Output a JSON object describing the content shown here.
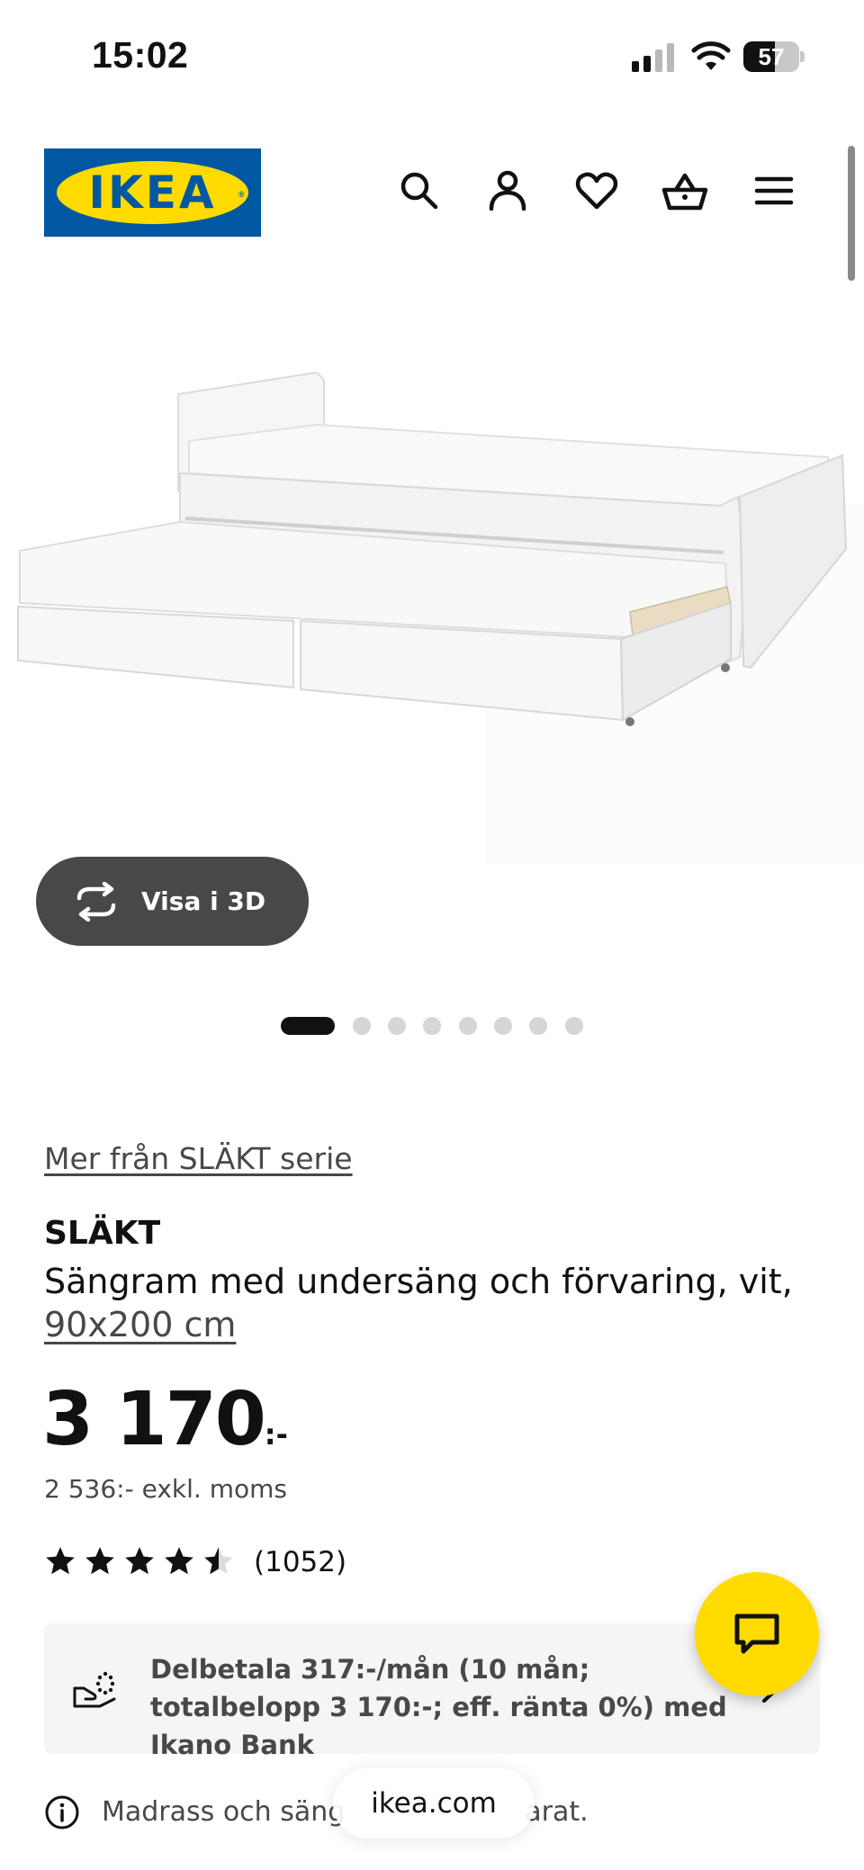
{
  "status_bar": {
    "time": "15:02",
    "battery": "57",
    "battery_level": 0.57,
    "icons": [
      "cellular-signal-icon",
      "wifi-icon",
      "battery-icon"
    ]
  },
  "header": {
    "logo_text": "IKEA",
    "logo_colors": {
      "background": "#0058a3",
      "oval": "#ffdb00"
    },
    "icons": [
      "search-icon",
      "account-icon",
      "heart-icon",
      "basket-icon",
      "menu-icon"
    ]
  },
  "gallery": {
    "view3d_label": "Visa i 3D",
    "dot_count": 8,
    "active_dot": 0
  },
  "product": {
    "series_link": "Mer från SLÄKT serie",
    "name": "SLÄKT",
    "description": "Sängram med undersäng och förvaring, vit,",
    "size": "90x200 cm",
    "price": "3 170",
    "price_suffix": ":-",
    "price_excl_vat": "2 536:- exkl. moms",
    "rating_value": 4,
    "rating_max": 5,
    "rating_count": "(1052)"
  },
  "finance": {
    "text": "Delbetala 317:-/mån (10 mån; totalbelopp 3 170:-; eff. ränta 0%) med Ikano Bank"
  },
  "note": {
    "text": "Madrass och säng",
    "text_tail": "arat."
  },
  "browser": {
    "url": "ikea.com"
  },
  "colors": {
    "ikea_blue": "#0058a3",
    "ikea_yellow": "#ffdb00",
    "dark_grey": "#484848"
  }
}
